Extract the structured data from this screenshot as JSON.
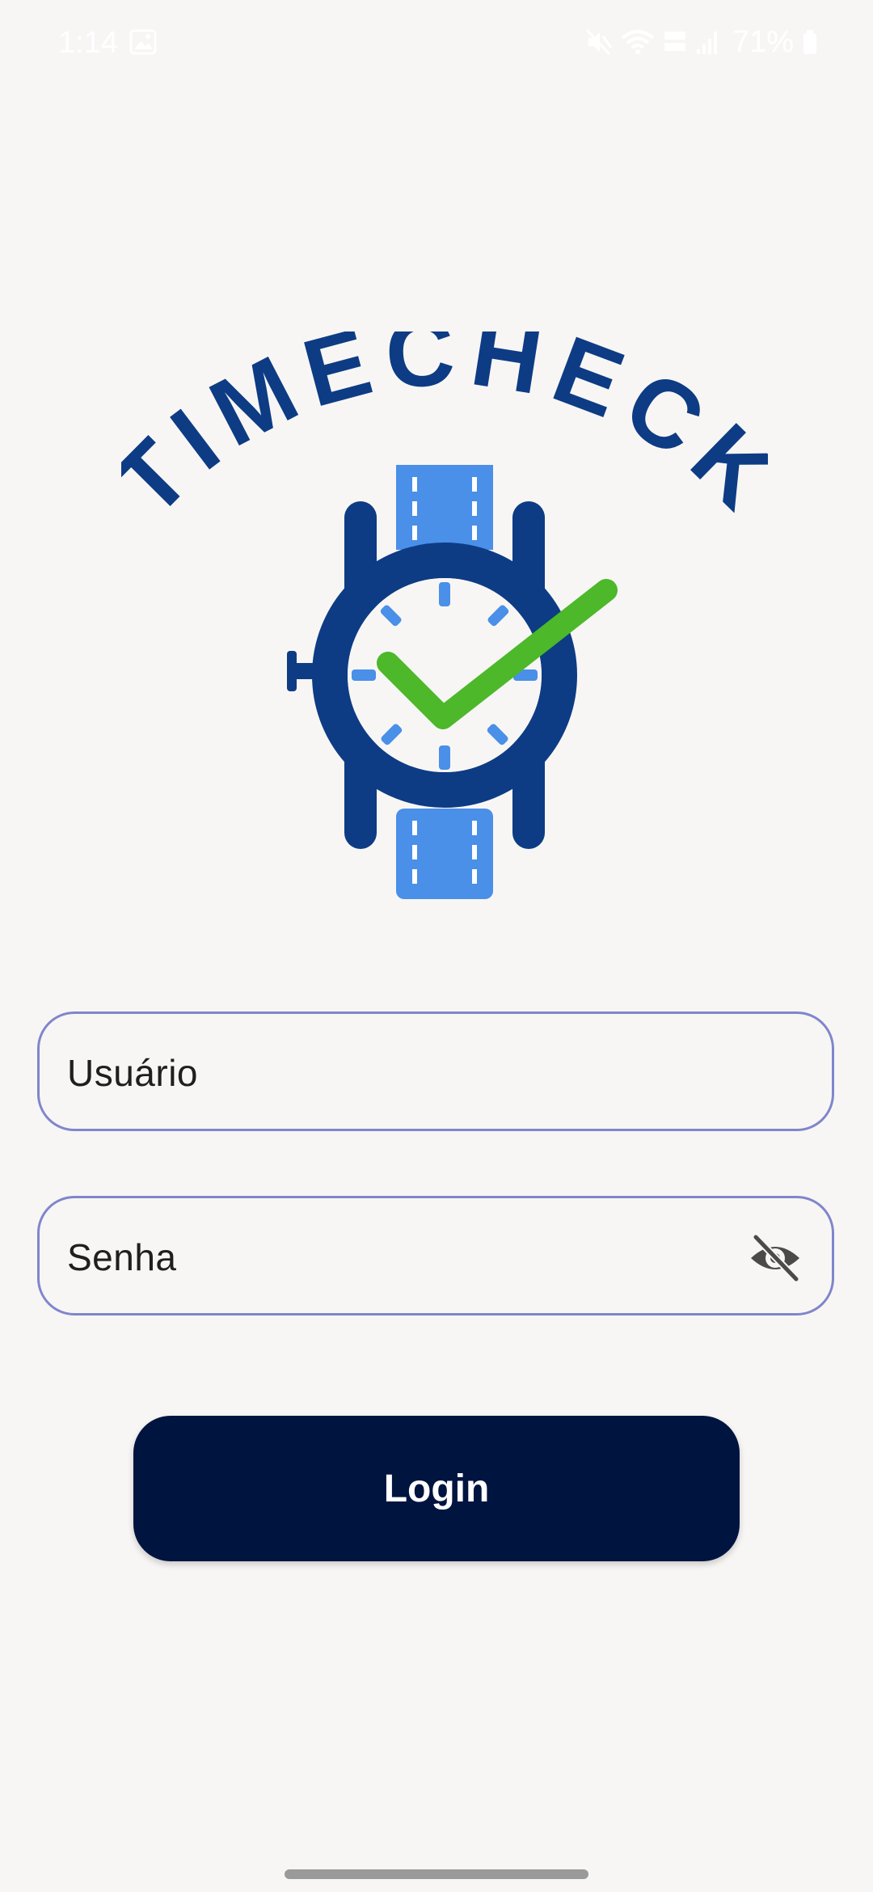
{
  "status_bar": {
    "time": "1:14",
    "battery": "71%",
    "icons": [
      "gallery-icon",
      "mute-icon",
      "wifi-icon",
      "volte-icon",
      "signal-icon",
      "battery-icon"
    ]
  },
  "logo": {
    "text": "TIMECHECK",
    "colors": {
      "dark_blue": "#0d3c85",
      "light_blue": "#4a8fe8",
      "check_green": "#4cb82a"
    }
  },
  "form": {
    "username_placeholder": "Usuário",
    "password_placeholder": "Senha",
    "password_toggle_icon": "eye-off-icon"
  },
  "login_button": {
    "label": "Login",
    "color": "#001440"
  },
  "theme": {
    "background": "#f8f6f4",
    "field_border": "#7f86cc"
  }
}
